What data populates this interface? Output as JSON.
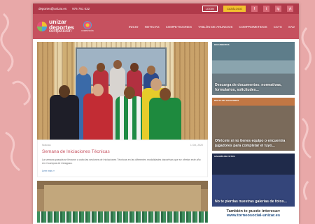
{
  "topbar": {
    "email": "deportes@unizar.es",
    "phone": "976 761 032",
    "login": "LOGIN",
    "catalog": "CATÁLOGO",
    "social": [
      "f",
      "t",
      "ig",
      "yt"
    ]
  },
  "header": {
    "logo": {
      "line1": "unizar",
      "line2": "deportes",
      "line3": "competición"
    },
    "logo2_text": "COMPETICIÓN",
    "nav": [
      "INICIO",
      "NOTICIAS",
      "COMPETICIONES",
      "TABLÓN DE ANUNCIOS",
      "COMPROMETIDOS",
      "CCTS",
      "SAD"
    ]
  },
  "news": {
    "category": "Noticias",
    "date": "1 Oct, 2020",
    "title": "Semana de Iniciaciones Técnicas",
    "body": "La semana pasada se llevaron a cabo las sesiones de Iniciaciones Técnicas en las diferentes modalidades deportivas que se ofertan este año en el campus de Zaragoza.",
    "read_more": "Leer más »"
  },
  "sidebar": {
    "cards": [
      {
        "tag": "DOCUMENTOS",
        "caption": "Descarga de documentos: normativas, formularios, solicitudes..."
      },
      {
        "tag": "BOLSA DE JUGADORES",
        "caption": "Ofrécete si no tienes equipo o encuentra jugadores para completar el tuyo..."
      },
      {
        "tag": "GALERÍA DE FOTOS",
        "caption": "No te pierdas nuestras galerías de fotos..."
      }
    ],
    "also_label": "También te puede interesar:",
    "also_link": "www.torneosocial-unizar.es"
  },
  "colors": {
    "brand": "#c6515f",
    "topbar": "#b03a4a",
    "accent": "#f2c12e",
    "background": "#e8a8a8"
  }
}
